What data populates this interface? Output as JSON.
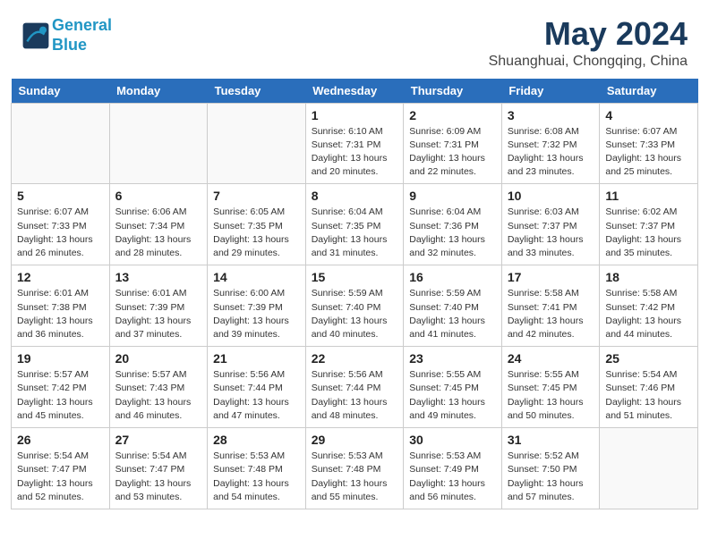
{
  "header": {
    "logo_line1": "General",
    "logo_line2": "Blue",
    "month_year": "May 2024",
    "location": "Shuanghuai, Chongqing, China"
  },
  "days_of_week": [
    "Sunday",
    "Monday",
    "Tuesday",
    "Wednesday",
    "Thursday",
    "Friday",
    "Saturday"
  ],
  "weeks": [
    [
      {
        "day": "",
        "info": ""
      },
      {
        "day": "",
        "info": ""
      },
      {
        "day": "",
        "info": ""
      },
      {
        "day": "1",
        "info": "Sunrise: 6:10 AM\nSunset: 7:31 PM\nDaylight: 13 hours and 20 minutes."
      },
      {
        "day": "2",
        "info": "Sunrise: 6:09 AM\nSunset: 7:31 PM\nDaylight: 13 hours and 22 minutes."
      },
      {
        "day": "3",
        "info": "Sunrise: 6:08 AM\nSunset: 7:32 PM\nDaylight: 13 hours and 23 minutes."
      },
      {
        "day": "4",
        "info": "Sunrise: 6:07 AM\nSunset: 7:33 PM\nDaylight: 13 hours and 25 minutes."
      }
    ],
    [
      {
        "day": "5",
        "info": "Sunrise: 6:07 AM\nSunset: 7:33 PM\nDaylight: 13 hours and 26 minutes."
      },
      {
        "day": "6",
        "info": "Sunrise: 6:06 AM\nSunset: 7:34 PM\nDaylight: 13 hours and 28 minutes."
      },
      {
        "day": "7",
        "info": "Sunrise: 6:05 AM\nSunset: 7:35 PM\nDaylight: 13 hours and 29 minutes."
      },
      {
        "day": "8",
        "info": "Sunrise: 6:04 AM\nSunset: 7:35 PM\nDaylight: 13 hours and 31 minutes."
      },
      {
        "day": "9",
        "info": "Sunrise: 6:04 AM\nSunset: 7:36 PM\nDaylight: 13 hours and 32 minutes."
      },
      {
        "day": "10",
        "info": "Sunrise: 6:03 AM\nSunset: 7:37 PM\nDaylight: 13 hours and 33 minutes."
      },
      {
        "day": "11",
        "info": "Sunrise: 6:02 AM\nSunset: 7:37 PM\nDaylight: 13 hours and 35 minutes."
      }
    ],
    [
      {
        "day": "12",
        "info": "Sunrise: 6:01 AM\nSunset: 7:38 PM\nDaylight: 13 hours and 36 minutes."
      },
      {
        "day": "13",
        "info": "Sunrise: 6:01 AM\nSunset: 7:39 PM\nDaylight: 13 hours and 37 minutes."
      },
      {
        "day": "14",
        "info": "Sunrise: 6:00 AM\nSunset: 7:39 PM\nDaylight: 13 hours and 39 minutes."
      },
      {
        "day": "15",
        "info": "Sunrise: 5:59 AM\nSunset: 7:40 PM\nDaylight: 13 hours and 40 minutes."
      },
      {
        "day": "16",
        "info": "Sunrise: 5:59 AM\nSunset: 7:40 PM\nDaylight: 13 hours and 41 minutes."
      },
      {
        "day": "17",
        "info": "Sunrise: 5:58 AM\nSunset: 7:41 PM\nDaylight: 13 hours and 42 minutes."
      },
      {
        "day": "18",
        "info": "Sunrise: 5:58 AM\nSunset: 7:42 PM\nDaylight: 13 hours and 44 minutes."
      }
    ],
    [
      {
        "day": "19",
        "info": "Sunrise: 5:57 AM\nSunset: 7:42 PM\nDaylight: 13 hours and 45 minutes."
      },
      {
        "day": "20",
        "info": "Sunrise: 5:57 AM\nSunset: 7:43 PM\nDaylight: 13 hours and 46 minutes."
      },
      {
        "day": "21",
        "info": "Sunrise: 5:56 AM\nSunset: 7:44 PM\nDaylight: 13 hours and 47 minutes."
      },
      {
        "day": "22",
        "info": "Sunrise: 5:56 AM\nSunset: 7:44 PM\nDaylight: 13 hours and 48 minutes."
      },
      {
        "day": "23",
        "info": "Sunrise: 5:55 AM\nSunset: 7:45 PM\nDaylight: 13 hours and 49 minutes."
      },
      {
        "day": "24",
        "info": "Sunrise: 5:55 AM\nSunset: 7:45 PM\nDaylight: 13 hours and 50 minutes."
      },
      {
        "day": "25",
        "info": "Sunrise: 5:54 AM\nSunset: 7:46 PM\nDaylight: 13 hours and 51 minutes."
      }
    ],
    [
      {
        "day": "26",
        "info": "Sunrise: 5:54 AM\nSunset: 7:47 PM\nDaylight: 13 hours and 52 minutes."
      },
      {
        "day": "27",
        "info": "Sunrise: 5:54 AM\nSunset: 7:47 PM\nDaylight: 13 hours and 53 minutes."
      },
      {
        "day": "28",
        "info": "Sunrise: 5:53 AM\nSunset: 7:48 PM\nDaylight: 13 hours and 54 minutes."
      },
      {
        "day": "29",
        "info": "Sunrise: 5:53 AM\nSunset: 7:48 PM\nDaylight: 13 hours and 55 minutes."
      },
      {
        "day": "30",
        "info": "Sunrise: 5:53 AM\nSunset: 7:49 PM\nDaylight: 13 hours and 56 minutes."
      },
      {
        "day": "31",
        "info": "Sunrise: 5:52 AM\nSunset: 7:50 PM\nDaylight: 13 hours and 57 minutes."
      },
      {
        "day": "",
        "info": ""
      }
    ]
  ]
}
